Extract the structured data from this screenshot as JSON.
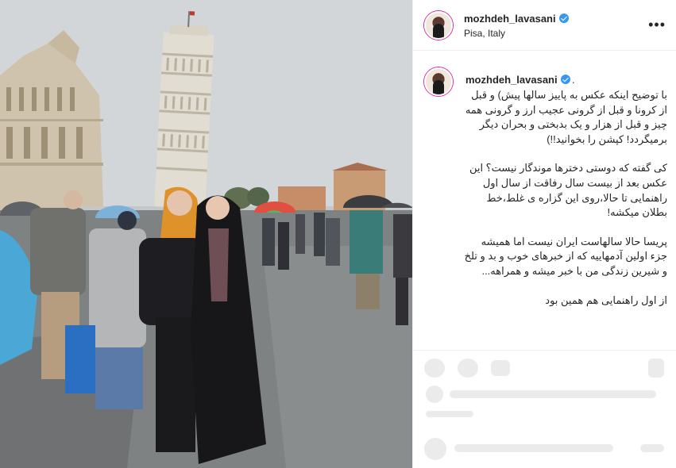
{
  "header": {
    "username": "mozhdeh_lavasani",
    "location": "Pisa, Italy",
    "more_label": "•••"
  },
  "caption": {
    "username": "mozhdeh_lavasani",
    "dot": ".",
    "paragraphs": [
      "با توضیح اینکه عکس به پاییز سالها پیش) و قبل از کرونا و قبل از گرونی عجیب ارز و گرونی همه چیز و قبل از هزار و یک بدبختی و بحران دیگر برمیگردد! کپشن را بخوانید!!)",
      "کی گفته که دوستی دخترها موندگار نیست؟ این عکس بعد از بیست سال رفاقت از سال اول راهنمایی تا حالا،روی این گزاره ی غلط،خط بطلان میکشه!",
      "پریسا حالا سالهاست ایران نیست اما همیشه جزء اولین آدمهاییه که از خبرهای خوب و بد و تلخ و شیرین زندگی من با خبر میشه و همراهه...",
      "از اول راهنمایی هم همین بود"
    ]
  },
  "colors": {
    "verified": "#3897f0",
    "text": "#262626",
    "border": "#efefef"
  },
  "icons": [
    "verified-badge-icon",
    "more-options-icon",
    "heart-icon",
    "comment-icon",
    "share-icon",
    "bookmark-icon",
    "emoji-icon"
  ]
}
